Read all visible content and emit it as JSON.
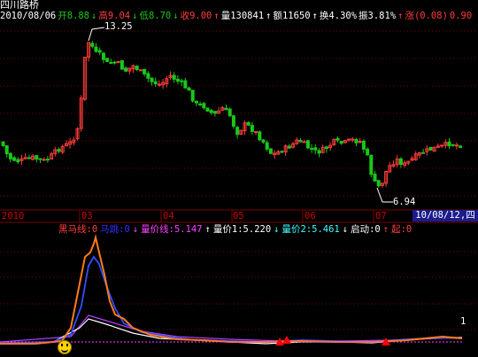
{
  "stock": {
    "name": "四川路桥"
  },
  "quote": [
    {
      "text": "2010/08/06",
      "color": "#ffffff"
    },
    {
      "text": "开8.88",
      "color": "#19c819"
    },
    {
      "text": "↓",
      "color": "#19c819"
    },
    {
      "text": "高9.04",
      "color": "#ff3c3c"
    },
    {
      "text": "↓",
      "color": "#19c819"
    },
    {
      "text": "低8.70",
      "color": "#19c819"
    },
    {
      "text": "↓",
      "color": "#19c819"
    },
    {
      "text": "收9.00",
      "color": "#ff3c3c"
    },
    {
      "text": "↑",
      "color": "#ff3c3c"
    },
    {
      "text": "量130841",
      "color": "#ffffff"
    },
    {
      "text": "↑",
      "color": "#ffffff"
    },
    {
      "text": "额11650",
      "color": "#ffffff"
    },
    {
      "text": "↑",
      "color": "#ffffff"
    },
    {
      "text": "换4.30%",
      "color": "#ffffff"
    },
    {
      "text": "振3.81%",
      "color": "#ffffff"
    },
    {
      "text": "↑",
      "color": "#ff3c3c"
    },
    {
      "text": "涨(0.08)",
      "color": "#ff3c3c"
    },
    {
      "text": "0.90",
      "color": "#ff3c3c"
    }
  ],
  "annotations": {
    "high": "13.25",
    "low": "6.94",
    "right_marker": "1"
  },
  "time_axis": {
    "labels": [
      "2010",
      "03",
      "04",
      "05",
      "06",
      "07"
    ],
    "current": "10/08/12,四"
  },
  "indicator": [
    {
      "text": "黑马线:0",
      "color": "#ff4040"
    },
    {
      "text": "马跳:0",
      "color": "#3030ff"
    },
    {
      "text": "↓",
      "color": "#ff40ff"
    },
    {
      "text": "量价线:5.147",
      "color": "#ff40ff"
    },
    {
      "text": "↑",
      "color": "#ffffff"
    },
    {
      "text": "量价1:5.220",
      "color": "#ffffff"
    },
    {
      "text": "↓",
      "color": "#40ffff"
    },
    {
      "text": "量价2:5.461",
      "color": "#40ffff"
    },
    {
      "text": "↓",
      "color": "#ffffff"
    },
    {
      "text": "启动:0",
      "color": "#ffffff"
    },
    {
      "text": "↑",
      "color": "#ff4040"
    },
    {
      "text": "起:0",
      "color": "#ff4040"
    }
  ],
  "colors": {
    "up": "#ff3c3c",
    "down": "#19c819",
    "grid": "#7a0000",
    "orange": "#ff7a1a",
    "blue": "#3050ff",
    "white": "#ffffff",
    "purple": "#b040ff"
  }
}
